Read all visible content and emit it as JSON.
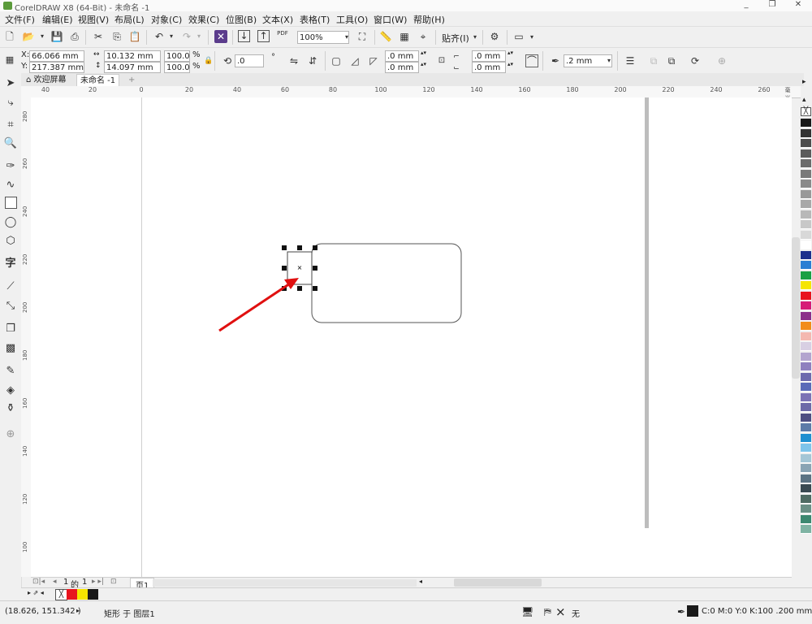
{
  "window": {
    "title": "CorelDRAW X8 (64-Bit) - 未命名 -1",
    "minimize": "_",
    "restore": "❐",
    "close": "✕"
  },
  "menu": {
    "items": [
      "文件(F)",
      "编辑(E)",
      "视图(V)",
      "布局(L)",
      "对象(C)",
      "效果(C)",
      "位图(B)",
      "文本(X)",
      "表格(T)",
      "工具(O)",
      "窗口(W)",
      "帮助(H)"
    ]
  },
  "toolbar1": {
    "zoom_value": "100%",
    "snap_label": "贴齐(I)",
    "pdf_label": "PDF"
  },
  "toolbar2": {
    "x_label": "X:",
    "x_value": "66.066 mm",
    "y_label": "Y:",
    "y_value": "217.387 mm",
    "width_value": "10.132 mm",
    "height_value": "14.097 mm",
    "scale_x": "100.0",
    "scale_y": "100.0",
    "percent": "%",
    "rotation": ".0",
    "degree": "°",
    "corner_1": ".0 mm",
    "corner_2": ".0 mm",
    "corner_3": ".0 mm",
    "corner_4": ".0 mm",
    "outline_width": ".2 mm"
  },
  "tabs": {
    "welcome": "欢迎屏幕",
    "document": "未命名 -1",
    "add": "+"
  },
  "ruler": {
    "h_labels": [
      "40",
      "20",
      "0",
      "20",
      "40",
      "60",
      "80",
      "100",
      "120",
      "140",
      "160",
      "180",
      "200",
      "220",
      "240",
      "260"
    ],
    "unit": "毫米",
    "v_labels": [
      "280",
      "260",
      "240",
      "220",
      "200",
      "180",
      "160",
      "140",
      "120",
      "100"
    ]
  },
  "pagenav": {
    "current": "1",
    "of": "的",
    "total": "1",
    "page_tab": "页1"
  },
  "status": {
    "coords": "(18.626, 151.342 )",
    "arrow": "▸",
    "object_info": "矩形 于 图层1",
    "fill_none": "无",
    "outline_info": "C:0 M:0 Y:0 K:100  .200 mm"
  },
  "colors": {
    "selection_handle": "#111111",
    "arrow": "#e01010",
    "palette": [
      "#1a1a1a",
      "#333333",
      "#4d4d4d",
      "#5c5c5c",
      "#6b6b6b",
      "#7a7a7a",
      "#8a8a8a",
      "#999999",
      "#a8a8a8",
      "#b8b8b8",
      "#c8c8c8",
      "#d8d8d8",
      "#ffffff",
      "#1d2f8c",
      "#2b7fd3",
      "#19a043",
      "#f5e500",
      "#e8141e",
      "#d61c77",
      "#8b2f8a",
      "#f28c1a",
      "#f4b8b0",
      "#d8cfe3",
      "#b3a5cf",
      "#8f80bf",
      "#6e6aad",
      "#5a6ab8",
      "#7c73b5",
      "#6d6aa8",
      "#4e4e82",
      "#5d7ba8",
      "#1f8fd0",
      "#7ec4ea",
      "#a4c6d6",
      "#8aa4b4",
      "#5c7383",
      "#3a4a52",
      "#4f6b63",
      "#6a8f85",
      "#3c8870",
      "#7fb3a3"
    ],
    "doc_palette": [
      "#e8141e",
      "#f5e500",
      "#1a1a1a"
    ]
  },
  "icons": {
    "pick": "pick-tool-icon",
    "shape": "shape-tool-icon",
    "crop": "crop-tool-icon",
    "zoom": "zoom-tool-icon",
    "freehand": "freehand-tool-icon",
    "artistic": "artistic-media-icon",
    "rectangle": "rectangle-tool-icon",
    "ellipse": "ellipse-tool-icon",
    "polygon": "polygon-tool-icon",
    "text": "text-tool-icon",
    "dimension": "dimension-tool-icon",
    "connector": "connector-tool-icon",
    "shadow": "drop-shadow-icon",
    "transparency": "transparency-icon",
    "eyedropper": "eyedropper-icon",
    "interactive_fill": "interactive-fill-icon",
    "smart_fill": "smart-fill-icon"
  }
}
